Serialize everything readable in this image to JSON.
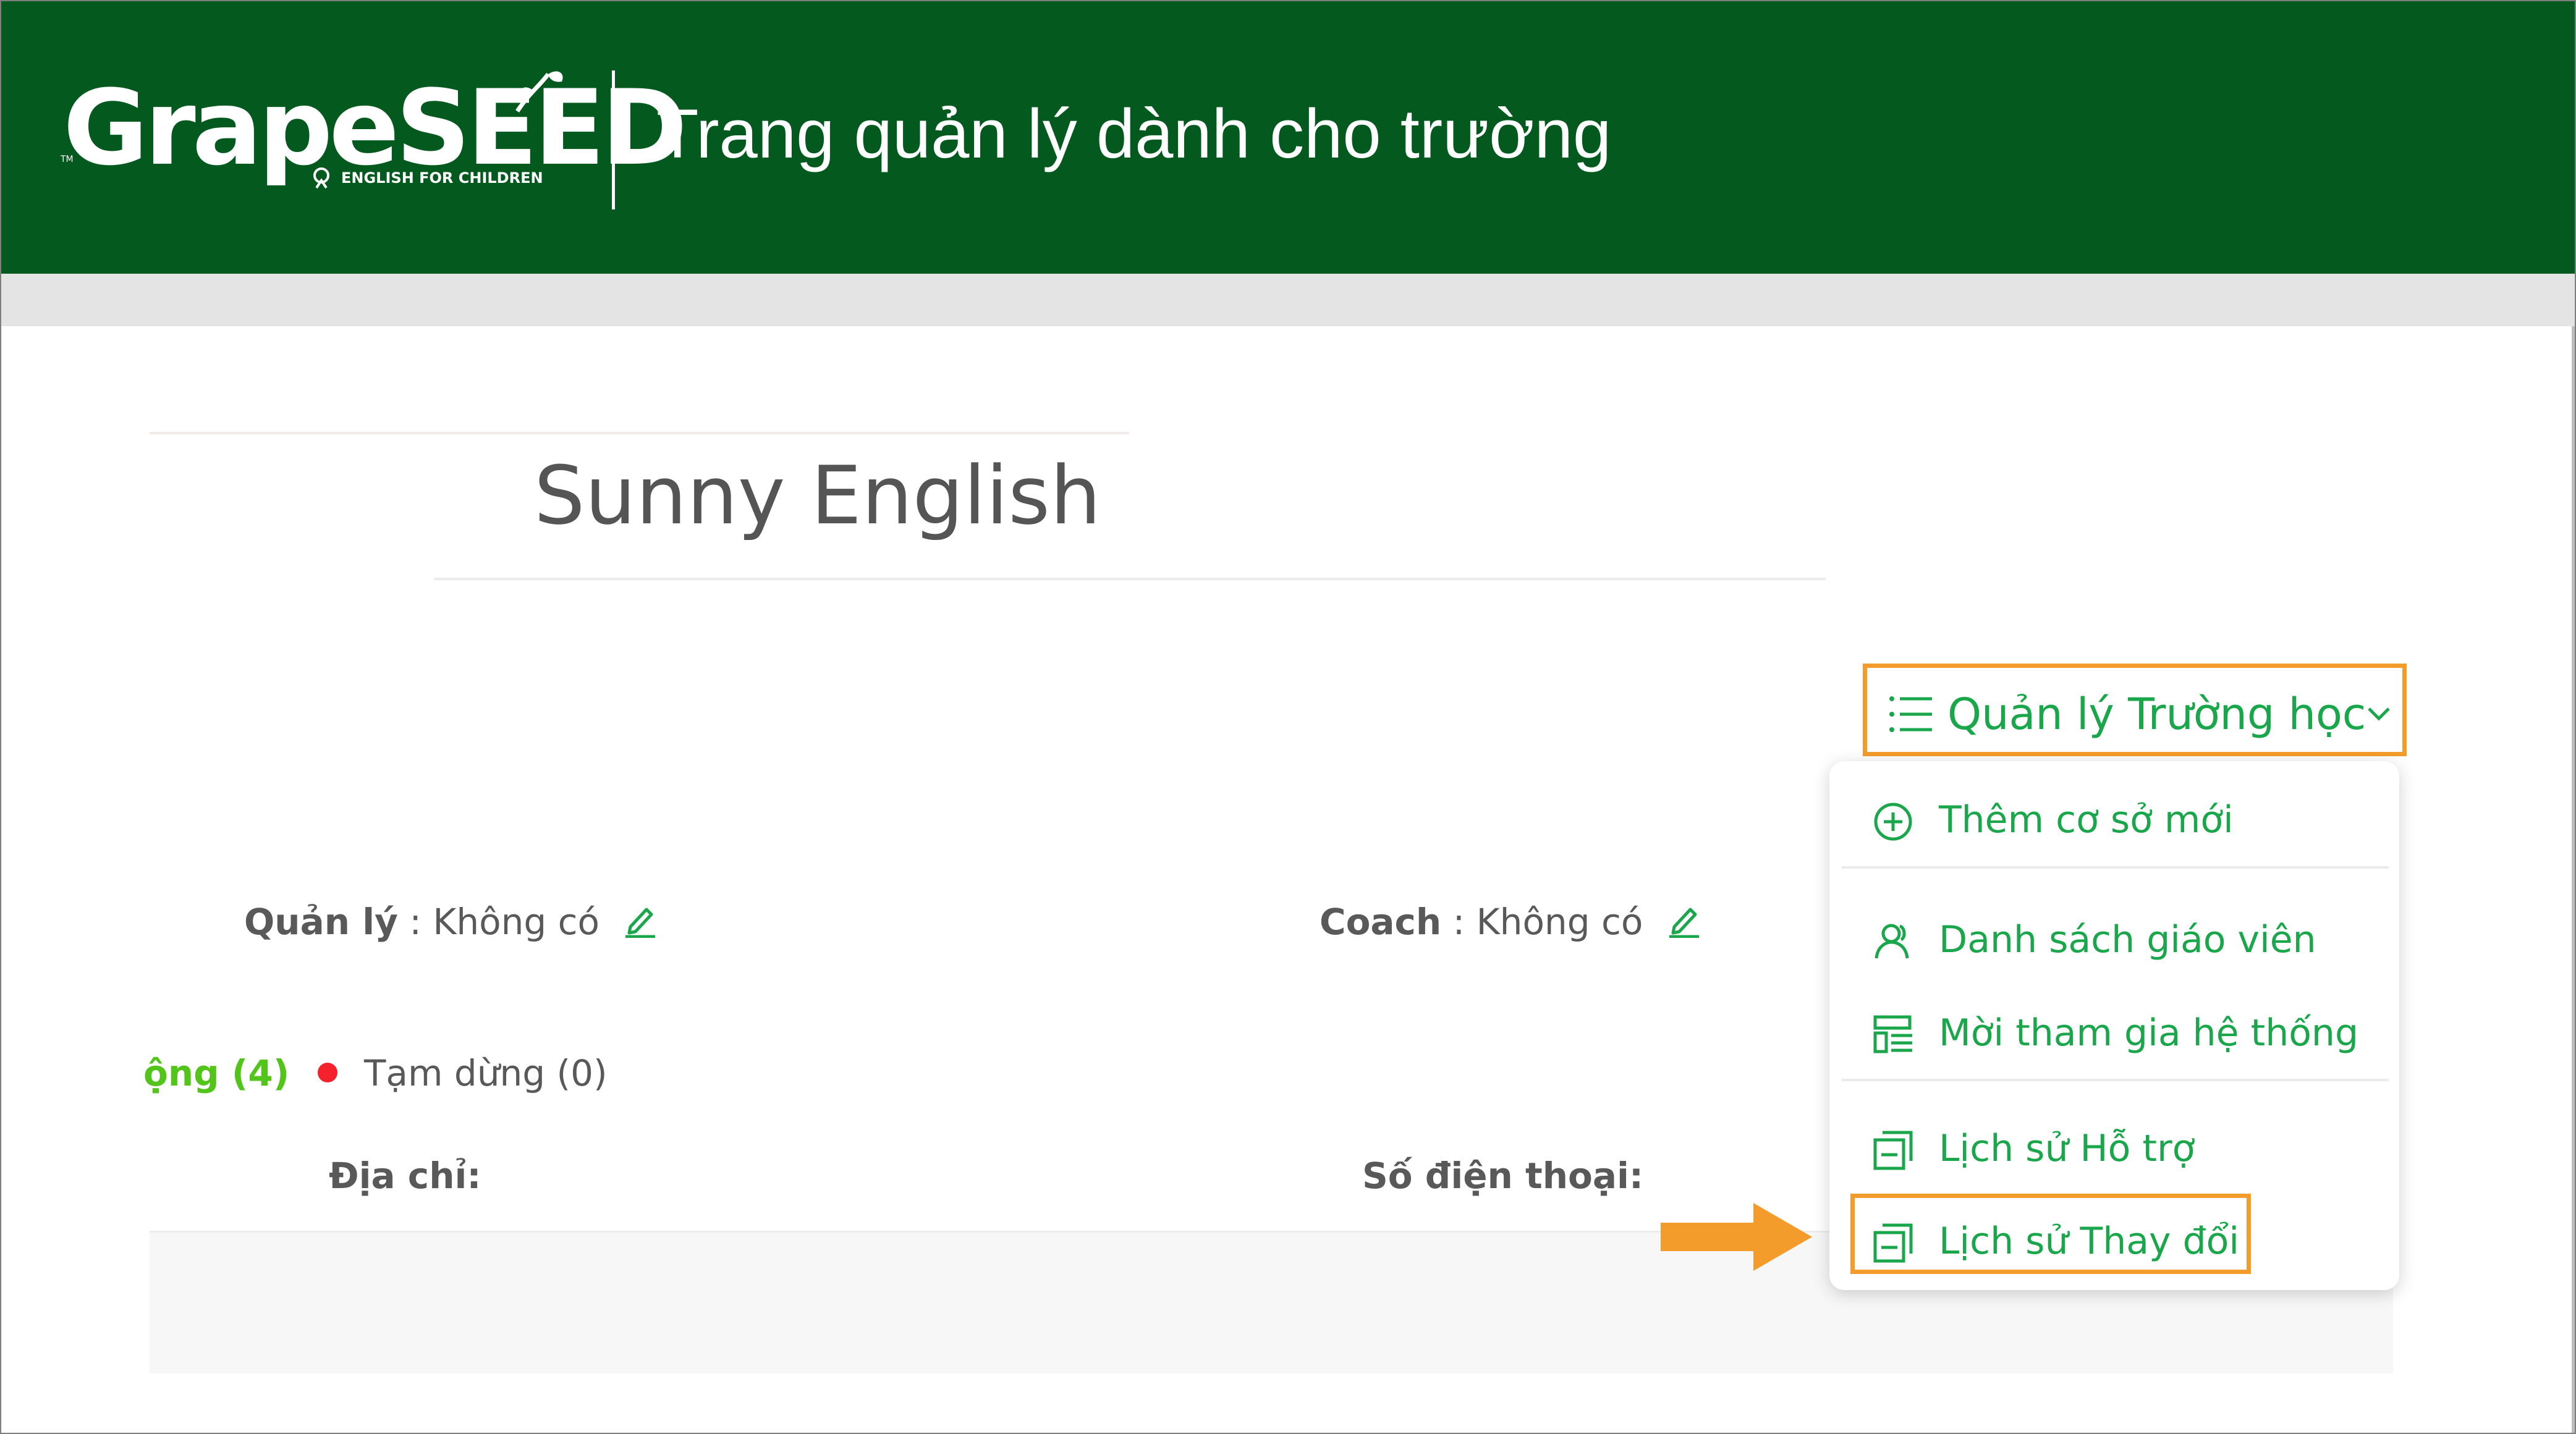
{
  "header": {
    "logo_text": "GrapeSEED",
    "logo_tagline": "ENGLISH FOR CHILDREN",
    "logo_tm": "TM",
    "title": "Trang quản lý dành cho trường",
    "background": "#03591e"
  },
  "school": {
    "name": "Sunny English",
    "manager_label": "Quản lý",
    "manager_value": ": Không có",
    "coach_label": "Coach",
    "coach_value": ": Không có"
  },
  "status": {
    "active": "ộng (4)",
    "paused": "Tạm dừng (0)"
  },
  "table": {
    "columns": [
      "Địa chỉ:",
      "Số điện thoại:"
    ]
  },
  "dropdown": {
    "trigger_label": "Quản lý Trường học",
    "items": [
      {
        "label": "Thêm cơ sở mới",
        "icon": "plus-circle-icon"
      },
      {
        "label": "Danh sách giáo viên",
        "icon": "users-icon"
      },
      {
        "label": "Mời tham gia hệ thống",
        "icon": "invite-form-icon"
      },
      {
        "label": "Lịch sử Hỗ trợ",
        "icon": "history-icon"
      },
      {
        "label": "Lịch sử Thay đổi",
        "icon": "history-icon"
      }
    ],
    "highlighted_item": "Lịch sử Thay đổi"
  },
  "colors": {
    "header_green": "#03591e",
    "accent_green": "#1aa64a",
    "status_green": "#52c41a",
    "status_red": "#f5222d",
    "highlight_orange": "#f39c2c"
  }
}
